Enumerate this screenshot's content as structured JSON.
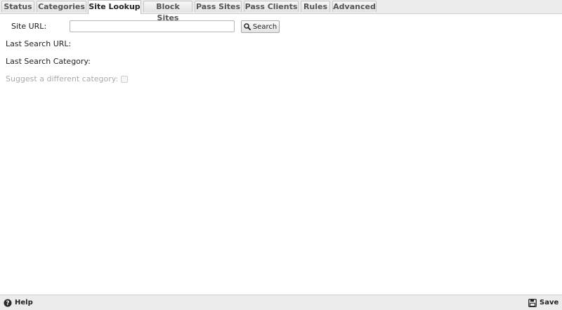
{
  "tabs": [
    {
      "label": "Status"
    },
    {
      "label": "Categories"
    },
    {
      "label": "Site Lookup"
    },
    {
      "label": "Block Sites"
    },
    {
      "label": "Pass Sites"
    },
    {
      "label": "Pass Clients"
    },
    {
      "label": "Rules"
    },
    {
      "label": "Advanced"
    }
  ],
  "active_tab": "Site Lookup",
  "form": {
    "site_url_label": "Site URL:",
    "site_url_value": "",
    "search_button": "Search",
    "last_search_url_label": "Last Search URL:",
    "last_search_url_value": "",
    "last_search_category_label": "Last Search Category:",
    "last_search_category_value": "",
    "suggest_label": "Suggest a different category:",
    "suggest_checked": false
  },
  "footer": {
    "help_label": "Help",
    "save_label": "Save"
  },
  "icons": {
    "search": "magnifier-icon",
    "help": "question-circle-icon",
    "save": "floppy-disk-icon"
  }
}
